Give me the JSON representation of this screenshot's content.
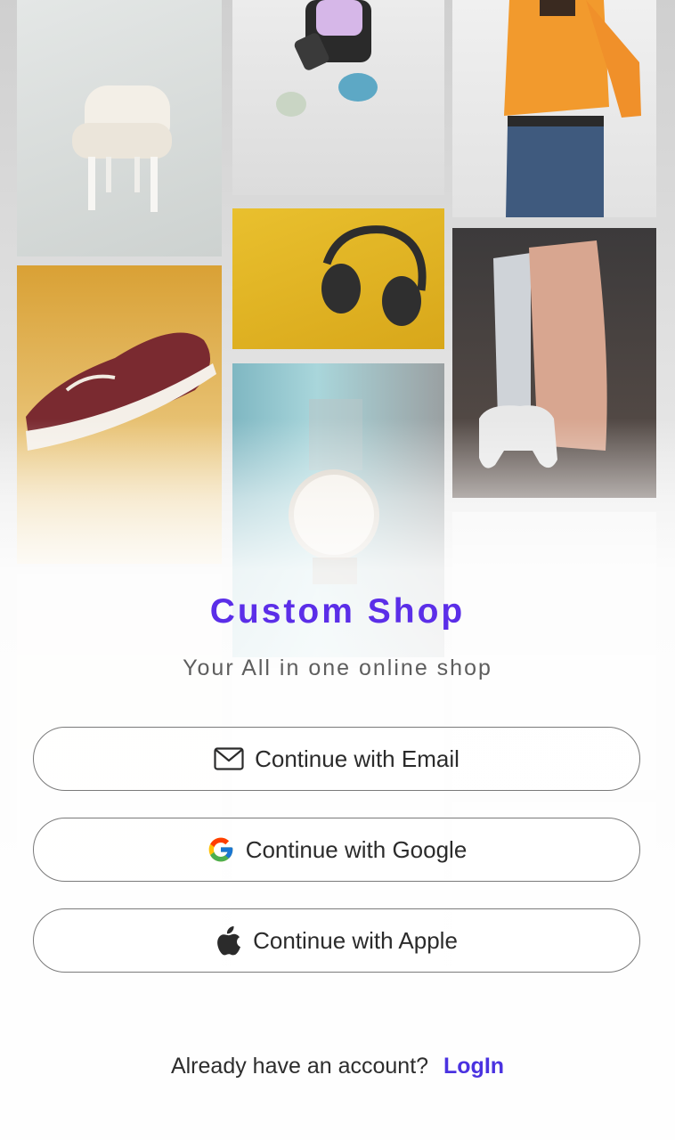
{
  "brand": {
    "title": "Custom Shop",
    "tagline": "Your All in one online shop",
    "accent_color": "#5b2ee8"
  },
  "auth_buttons": [
    {
      "label": "Continue with Email",
      "icon": "mail-icon"
    },
    {
      "label": "Continue with Google",
      "icon": "google-logo-icon"
    },
    {
      "label": "Continue with Apple",
      "icon": "apple-logo-icon"
    }
  ],
  "footer": {
    "prompt": "Already have an account?",
    "login_label": "LogIn",
    "login_color": "#4a32e0"
  },
  "background_tiles": [
    "chair-image",
    "smartwatch-image",
    "orange-sweater-person-image",
    "headphones-image",
    "game-console-image",
    "sneaker-image",
    "wristwatch-image"
  ]
}
